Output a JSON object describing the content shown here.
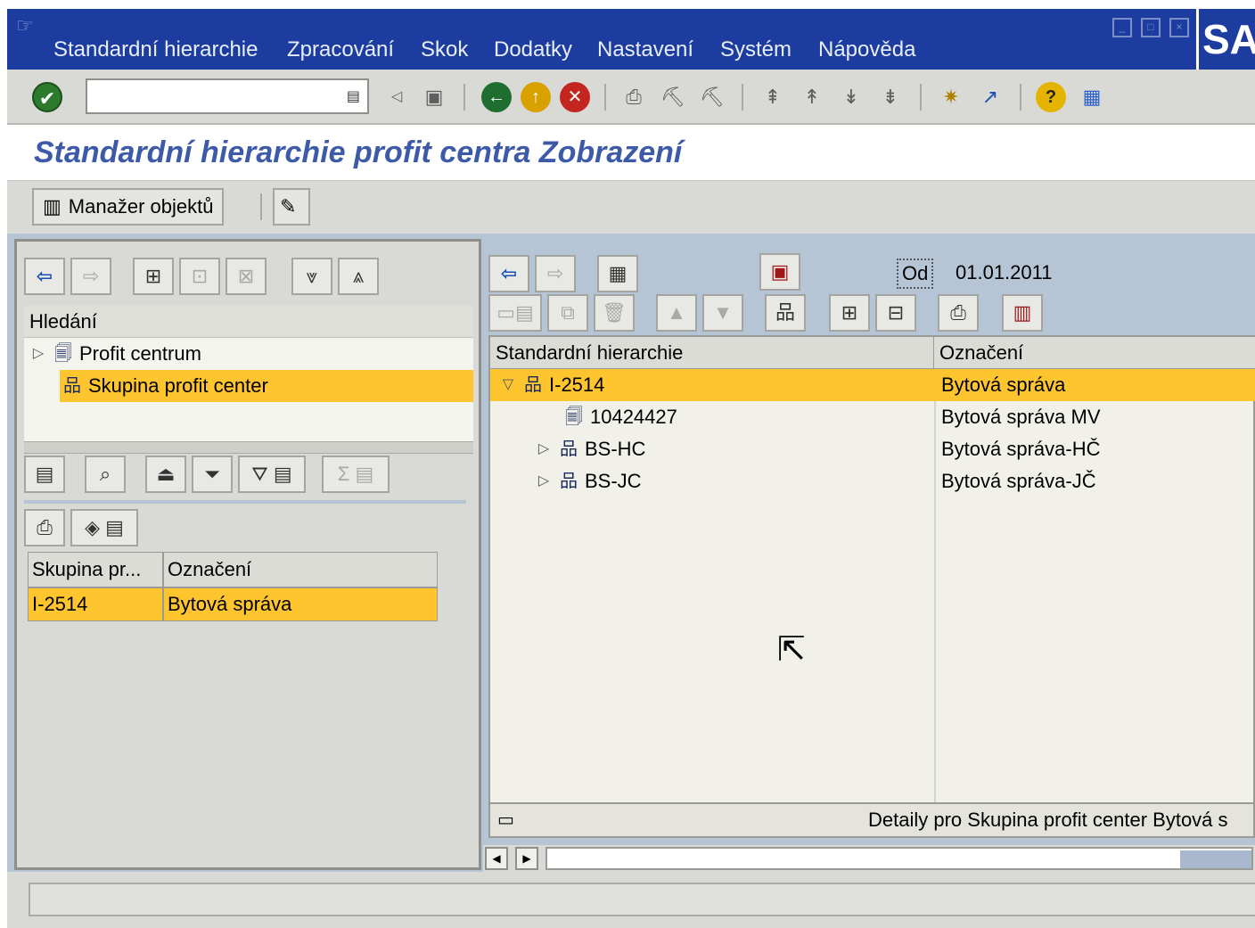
{
  "window": {
    "menu": [
      "Standardní hierarchie",
      "Zpracování",
      "Skok",
      "Dodatky",
      "Nastavení",
      "Systém",
      "Nápověda"
    ],
    "logo": "SA"
  },
  "toolbar": {
    "command_field_value": ""
  },
  "page": {
    "title": "Standardní hierarchie profit centra Zobrazení"
  },
  "app_toolbar": {
    "object_manager_label": "Manažer objektů"
  },
  "left_panel": {
    "search_header": "Hledání",
    "tree": [
      {
        "label": "Profit centrum",
        "selected": false,
        "expandable": true
      },
      {
        "label": "Skupina profit center",
        "selected": true,
        "expandable": false
      }
    ],
    "results": {
      "columns": [
        "Skupina pr...",
        "Označení"
      ],
      "rows": [
        {
          "group": "I-2514",
          "desc": "Bytová správa"
        }
      ]
    }
  },
  "right_panel": {
    "date_label": "Od",
    "date_value": "01.01.2011",
    "columns": [
      "Standardní hierarchie",
      "Označení"
    ],
    "rows": [
      {
        "name": "I-2514",
        "desc": "Bytová správa",
        "level": 0,
        "expander": "expanded",
        "icon": "hierarchy-group-icon",
        "selected": true
      },
      {
        "name": "10424427",
        "desc": "Bytová správa MV",
        "level": 1,
        "expander": "none",
        "icon": "profit-center-icon",
        "selected": false
      },
      {
        "name": "BS-HC",
        "desc": "Bytová správa-HČ",
        "level": 1,
        "expander": "collapsed",
        "icon": "hierarchy-group-icon",
        "selected": false
      },
      {
        "name": "BS-JC",
        "desc": "Bytová správa-JČ",
        "level": 1,
        "expander": "collapsed",
        "icon": "hierarchy-group-icon",
        "selected": false
      }
    ],
    "detail_text": "Detaily pro Skupina profit center Bytová s"
  },
  "status_bar": {
    "text": ""
  },
  "colors": {
    "menubar": "#1c3ca0",
    "selection": "#ffc52e",
    "title": "#3d5aa8",
    "chrome": "#d9d9d6"
  }
}
